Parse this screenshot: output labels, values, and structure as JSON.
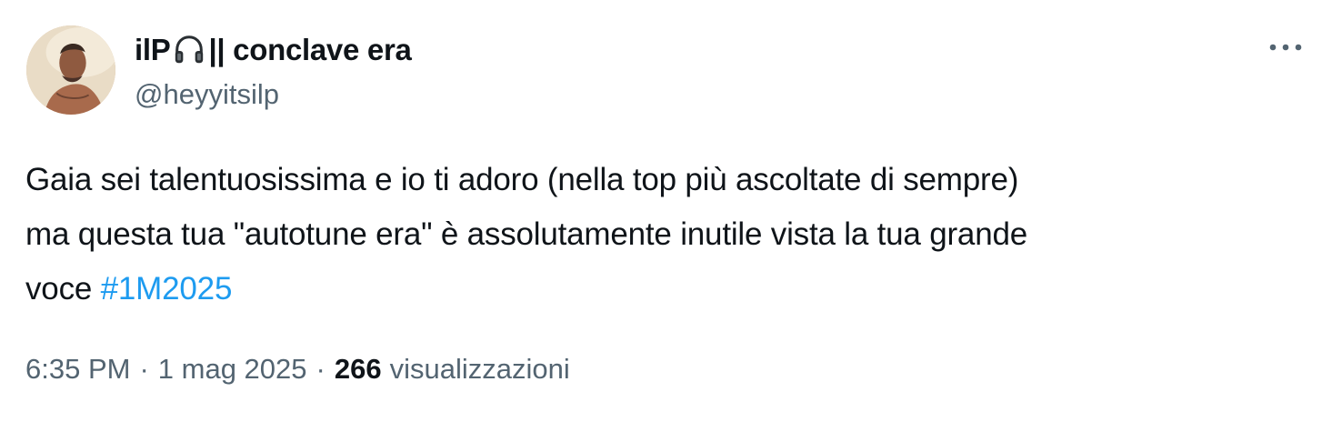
{
  "author": {
    "display_name_prefix": "ilP",
    "headphones_icon": "headphones-icon",
    "display_name_suffix": "|| conclave era",
    "handle": "@heyyitsilp",
    "avatar": "user-avatar-photo"
  },
  "more_icon": "more-horizontal-icon",
  "tweet": {
    "line1": "Gaia sei talentuosissima e io ti adoro (nella top più ascoltate di sempre)",
    "line2": "ma questa tua \"autotune era\" è assolutamente inutile vista la tua grande",
    "line3_text": "voce ",
    "hashtag": "#1M2025"
  },
  "meta": {
    "time": "6:35 PM",
    "separator": "·",
    "date": "1 mag 2025",
    "views_count": "266",
    "views_label": "visualizzazioni"
  },
  "colors": {
    "text": "#0f1419",
    "secondary": "#536471",
    "link": "#1d9bf0"
  }
}
